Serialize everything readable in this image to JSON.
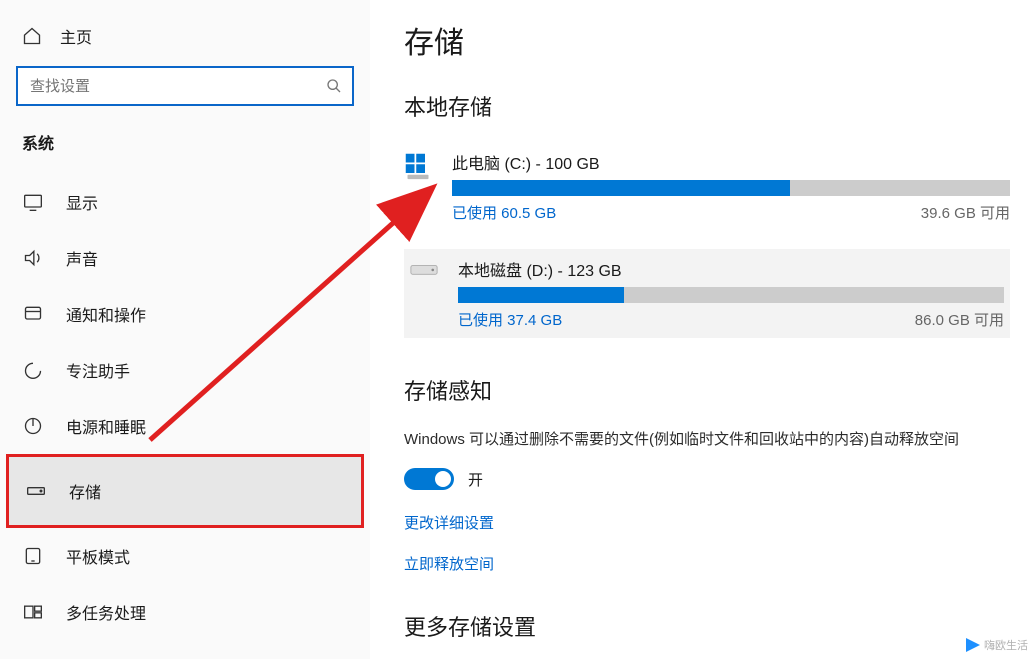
{
  "sidebar": {
    "home": "主页",
    "search_placeholder": "查找设置",
    "section": "系统",
    "items": [
      {
        "label": "显示",
        "icon": "display"
      },
      {
        "label": "声音",
        "icon": "sound"
      },
      {
        "label": "通知和操作",
        "icon": "notification"
      },
      {
        "label": "专注助手",
        "icon": "focus"
      },
      {
        "label": "电源和睡眠",
        "icon": "power"
      },
      {
        "label": "存储",
        "icon": "storage",
        "selected": true
      },
      {
        "label": "平板模式",
        "icon": "tablet"
      },
      {
        "label": "多任务处理",
        "icon": "multitask"
      }
    ]
  },
  "main": {
    "title": "存储",
    "local_storage_title": "本地存储",
    "disks": [
      {
        "title": "此电脑 (C:) - 100 GB",
        "used_label": "已使用 60.5 GB",
        "free_label": "39.6 GB 可用",
        "percent": 60.5,
        "icon": "windows-drive"
      },
      {
        "title": "本地磁盘 (D:) - 123 GB",
        "used_label": "已使用 37.4 GB",
        "free_label": "86.0 GB 可用",
        "percent": 30.4,
        "icon": "hdd-drive"
      }
    ],
    "sense_title": "存储感知",
    "sense_desc": "Windows 可以通过删除不需要的文件(例如临时文件和回收站中的内容)自动释放空间",
    "toggle_label": "开",
    "link_detail": "更改详细设置",
    "link_free": "立即释放空间",
    "more_title": "更多存储设置"
  },
  "watermark": "嗨欧生活"
}
